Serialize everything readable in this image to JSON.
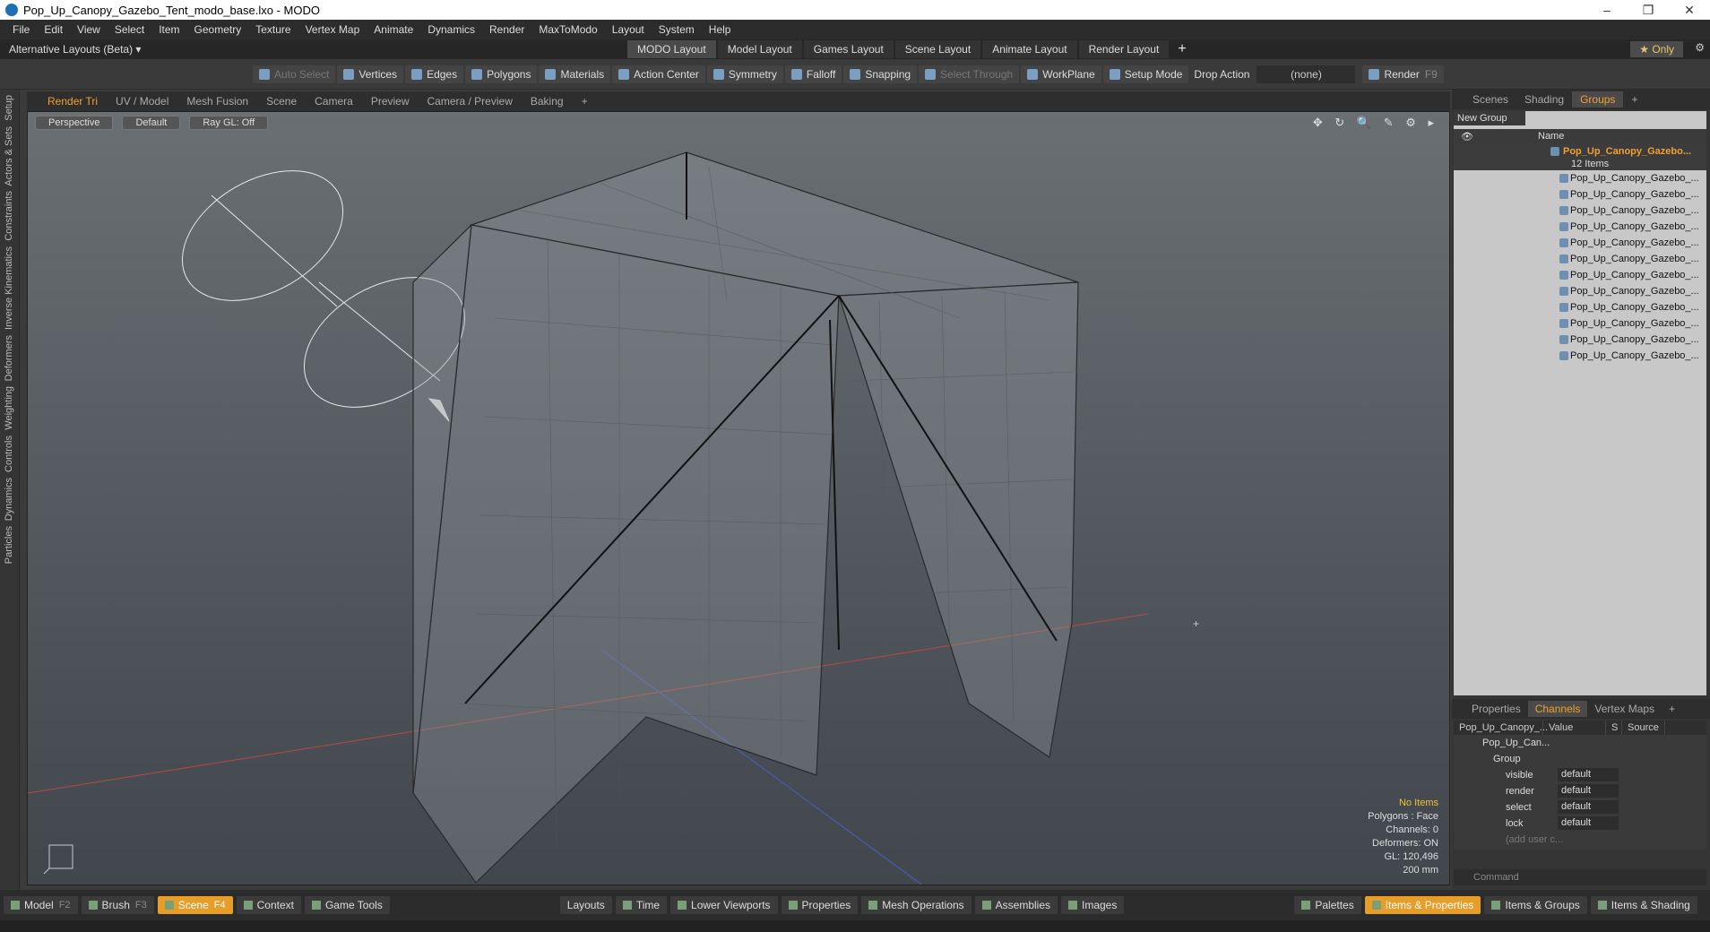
{
  "window": {
    "title": "Pop_Up_Canopy_Gazebo_Tent_modo_base.lxo - MODO",
    "minimize": "–",
    "restore": "❐",
    "close": "✕"
  },
  "menu": [
    "File",
    "Edit",
    "View",
    "Select",
    "Item",
    "Geometry",
    "Texture",
    "Vertex Map",
    "Animate",
    "Dynamics",
    "Render",
    "MaxToModo",
    "Layout",
    "System",
    "Help"
  ],
  "layouts": {
    "alt": "Alternative Layouts (Beta) ▾",
    "tabs": [
      "MODO Layout",
      "Model Layout",
      "Games Layout",
      "Scene Layout",
      "Animate Layout",
      "Render Layout"
    ],
    "plus": "+",
    "only": "★ Only"
  },
  "toolbar": {
    "auto_select": "Auto Select",
    "vertices": "Vertices",
    "edges": "Edges",
    "polygons": "Polygons",
    "materials": "Materials",
    "action_center": "Action Center",
    "symmetry": "Symmetry",
    "falloff": "Falloff",
    "snapping": "Snapping",
    "select_through": "Select Through",
    "workplane": "WorkPlane",
    "setup_mode": "Setup Mode",
    "drop_action": "Drop Action",
    "drop_value": "(none)",
    "render": "Render",
    "render_key": "F9"
  },
  "left_tabs": [
    "Setup",
    "Actors & Sets",
    "Constraints",
    "Inverse Kinematics",
    "Deformers",
    "Weighting",
    "Controls",
    "Dynamics",
    "Particles"
  ],
  "viewport": {
    "tabs": [
      "Render Tri",
      "UV / Model",
      "Mesh Fusion",
      "Scene",
      "Camera",
      "Preview",
      "Camera / Preview",
      "Baking",
      "+"
    ],
    "perspective": "Perspective",
    "default": "Default",
    "raygl": "Ray GL: Off",
    "icons": "✥ ↻ 🔍 ✎ ⚙ ▸",
    "info": {
      "no_items": "No Items",
      "polygons": "Polygons : Face",
      "channels": "Channels: 0",
      "deformers": "Deformers: ON",
      "gl": "GL: 120,496",
      "scale": "200 mm"
    }
  },
  "right_tabs": [
    "Scenes",
    "Shading",
    "Groups",
    "+"
  ],
  "groups": {
    "new_group": "New Group",
    "name_col": "Name",
    "root": "Pop_Up_Canopy_Gazebo...",
    "root_count": "12 Items",
    "items": [
      "Pop_Up_Canopy_Gazebo_...",
      "Pop_Up_Canopy_Gazebo_...",
      "Pop_Up_Canopy_Gazebo_...",
      "Pop_Up_Canopy_Gazebo_...",
      "Pop_Up_Canopy_Gazebo_...",
      "Pop_Up_Canopy_Gazebo_...",
      "Pop_Up_Canopy_Gazebo_...",
      "Pop_Up_Canopy_Gazebo_...",
      "Pop_Up_Canopy_Gazebo_...",
      "Pop_Up_Canopy_Gazebo_...",
      "Pop_Up_Canopy_Gazebo_...",
      "Pop_Up_Canopy_Gazebo_..."
    ]
  },
  "channel_tabs": [
    "Properties",
    "Channels",
    "Vertex Maps",
    "+"
  ],
  "channels": {
    "col1": "Pop_Up_Canopy_...",
    "col2": "Value",
    "col3": "S",
    "col4": "Source",
    "item": "Pop_Up_Can...",
    "group": "Group",
    "rows": [
      {
        "k": "visible",
        "v": "default"
      },
      {
        "k": "render",
        "v": "default"
      },
      {
        "k": "select",
        "v": "default"
      },
      {
        "k": "lock",
        "v": "default"
      }
    ],
    "add": "(add user c..."
  },
  "command": {
    "placeholder": "Command"
  },
  "bottom": {
    "model": "Model",
    "model_key": "F2",
    "brush": "Brush",
    "brush_key": "F3",
    "scene": "Scene",
    "scene_key": "F4",
    "context": "Context",
    "game_tools": "Game Tools",
    "layouts": "Layouts",
    "time": "Time",
    "lower": "Lower Viewports",
    "properties": "Properties",
    "mesh_ops": "Mesh Operations",
    "assemblies": "Assemblies",
    "images": "Images",
    "palettes": "Palettes",
    "items_props": "Items & Properties",
    "items_groups": "Items & Groups",
    "items_shading": "Items & Shading"
  }
}
